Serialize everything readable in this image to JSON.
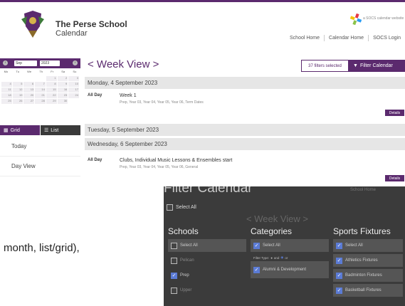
{
  "header": {
    "school_name": "The Perse School",
    "calendar_name": "Calendar",
    "socs_badge": "a SOCS calendar website",
    "nav": [
      "School Home",
      "Calendar Home",
      "SOCS Login"
    ]
  },
  "mini_calendar": {
    "month": "Sep",
    "year": "2023",
    "dow": [
      "Mo",
      "Tu",
      "We",
      "Th",
      "Fr",
      "Sa",
      "Su"
    ],
    "days": [
      "",
      "",
      "",
      "",
      "1",
      "2",
      "3",
      "4",
      "5",
      "6",
      "7",
      "8",
      "9",
      "10",
      "11",
      "12",
      "13",
      "14",
      "15",
      "16",
      "17",
      "18",
      "19",
      "20",
      "21",
      "22",
      "23",
      "24",
      "25",
      "26",
      "27",
      "28",
      "29",
      "30",
      ""
    ]
  },
  "view_toggle": {
    "grid": "Grid",
    "list": "List"
  },
  "side_links": [
    "Today",
    "Day View"
  ],
  "main": {
    "title": "< Week View >",
    "filters_selected": "37 filters selected",
    "filter_button": "Filter Calendar",
    "details": "Details",
    "days": [
      {
        "date": "Monday, 4 September 2023",
        "events": [
          {
            "time": "All Day",
            "title": "Week 1",
            "sub": "Prep, Year 03, Year 04, Year 05, Year 06, Term Dates"
          }
        ]
      },
      {
        "date": "Tuesday, 5 September 2023",
        "events": []
      },
      {
        "date": "Wednesday, 6 September 2023",
        "events": [
          {
            "time": "All Day",
            "title": "Clubs, Individual Music Lessons & Ensembles start",
            "sub": "Prep, Year 03, Year 04, Year 05, Year 06, General"
          }
        ]
      }
    ]
  },
  "caption": "month, list/grid),",
  "inset": {
    "title": "Filter Calendar",
    "bg_home": "School Home",
    "select_all_top": "Select All",
    "bg_week_view": "< Week View >",
    "columns": [
      {
        "title": "Schools",
        "options": [
          {
            "label": "Select All",
            "checked": false
          },
          {
            "label": "Pelican",
            "checked": false
          },
          {
            "label": "Prep",
            "checked": true
          },
          {
            "label": "Upper",
            "checked": false
          }
        ]
      },
      {
        "title": "Categories",
        "options": [
          {
            "label": "Select All",
            "checked": true
          },
          {
            "label": "Alumni & Development",
            "checked": true
          }
        ],
        "filter_type": {
          "label": "Filter Type:",
          "and": "and",
          "or": "or"
        }
      },
      {
        "title": "Sports Fixtures",
        "options": [
          {
            "label": "Select All",
            "checked": true
          },
          {
            "label": "Athletics Fixtures",
            "checked": true
          },
          {
            "label": "Badminton Fixtures",
            "checked": true
          },
          {
            "label": "Basketball Fixtures",
            "checked": true
          }
        ]
      }
    ]
  },
  "colors": {
    "brand": "#5b2a6e",
    "accent_check": "#5b7bd5",
    "day_bar": "#e6e6e6"
  }
}
